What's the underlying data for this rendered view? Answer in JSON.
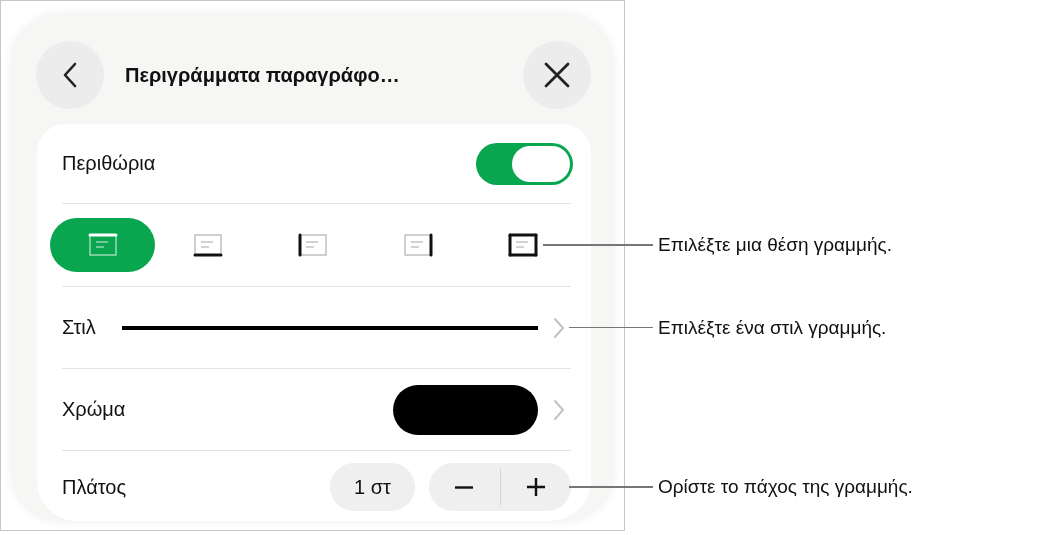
{
  "header": {
    "title": "Περιγράμματα παραγράφο…"
  },
  "borders": {
    "label": "Περιθώρια",
    "on": true
  },
  "positions": {
    "callout": "Επιλέξτε μια θέση γραμμής.",
    "items": [
      {
        "kind": "top",
        "selected": true
      },
      {
        "kind": "bottom",
        "selected": false
      },
      {
        "kind": "left",
        "selected": false
      },
      {
        "kind": "right",
        "selected": false
      },
      {
        "kind": "all",
        "selected": false
      }
    ]
  },
  "style_row": {
    "label": "Στιλ",
    "callout": "Επιλέξτε ένα στιλ γραμμής."
  },
  "color_row": {
    "label": "Χρώμα"
  },
  "width_row": {
    "label": "Πλάτος",
    "value": "1 στ",
    "callout": "Ορίστε το πάχος της γραμμής."
  }
}
